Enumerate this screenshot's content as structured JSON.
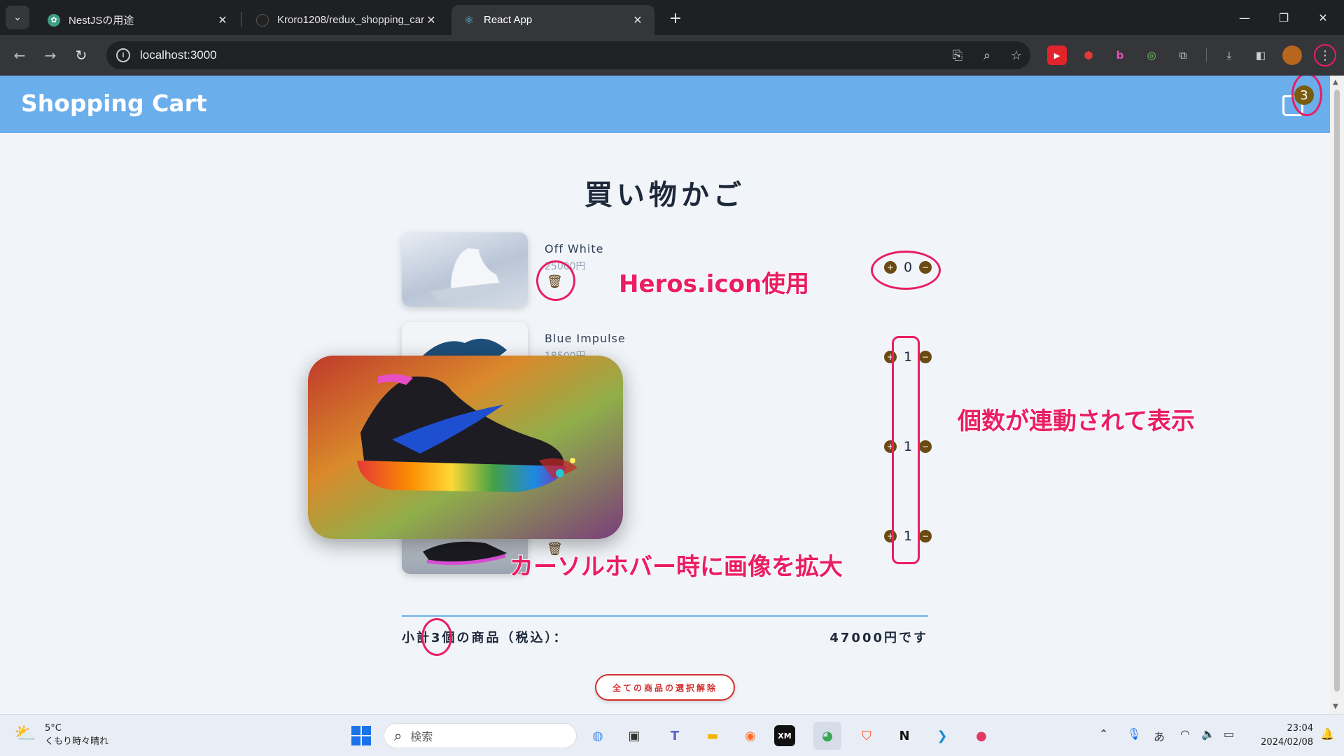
{
  "browser": {
    "tabs": [
      {
        "title": "NestJSの用途",
        "close": "✕"
      },
      {
        "title": "Kroro1208/redux_shopping_cart",
        "close": "✕"
      },
      {
        "title": "React App",
        "close": "✕"
      }
    ],
    "new_tab": "+",
    "url": "localhost:3000",
    "window": {
      "minimize": "—",
      "restore": "❐",
      "close": "✕"
    }
  },
  "app": {
    "brand": "Shopping Cart",
    "cart_count": "3",
    "page_title": "買い物かご",
    "items": [
      {
        "name": "Off White",
        "price": "25000円",
        "quantity": "0",
        "image": "white-sneaker"
      },
      {
        "name": "Blue Impulse",
        "price": "18500円",
        "quantity": "1",
        "image": "blue-splash-sneaker"
      },
      {
        "name": "",
        "price": "",
        "quantity": "1",
        "image": "hidden-item"
      },
      {
        "name": "",
        "price": "",
        "quantity": "1",
        "image": "black-pink-sneaker"
      }
    ],
    "qty_increase": "+",
    "qty_decrease": "−",
    "subtotal_label": "小計3個の商品（税込）：",
    "subtotal_value": "47000円です",
    "clear_button": "全ての商品の選択解除"
  },
  "annotations": {
    "heroicons": "Heros.icon使用",
    "quantity_linked": "個数が連動されて表示",
    "hover_zoom": "カーソルホバー時に画像を拡大",
    "color": "#e91e63"
  },
  "taskbar": {
    "weather_temp": "5°C",
    "weather_desc": "くもり時々晴れ",
    "search_placeholder": "検索",
    "ime": "あ",
    "time": "23:04",
    "date": "2024/02/08"
  },
  "colors": {
    "header": "#6aaeec",
    "accent_brown": "#6b4a12",
    "danger": "#d32f2f"
  }
}
